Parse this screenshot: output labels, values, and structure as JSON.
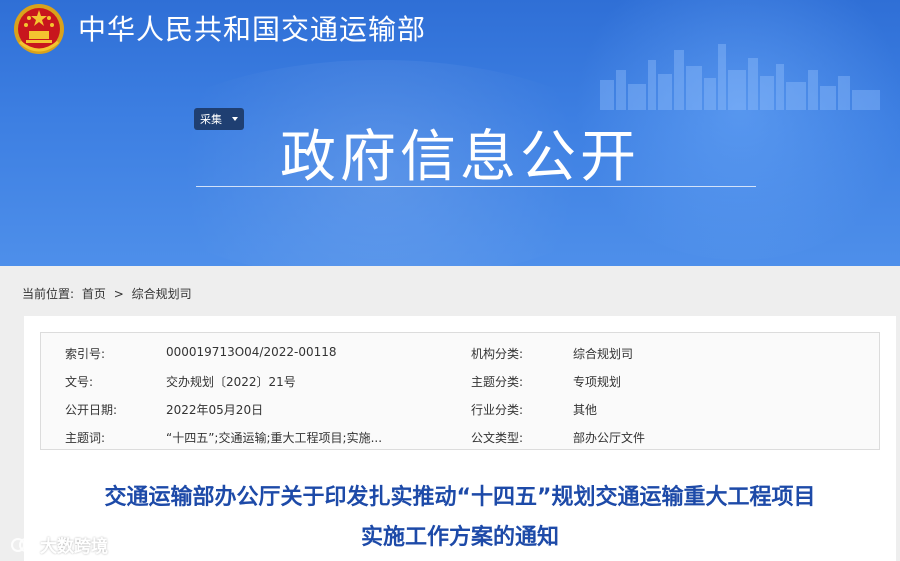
{
  "header": {
    "site_title": "中华人民共和国交通运输部",
    "dropdown_label": "采集",
    "section_title": "政府信息公开",
    "colors": {
      "banner_blue": "#3d7fe2",
      "title_blue": "#1d4aa8",
      "dropdown_bg": "#1f3f72"
    }
  },
  "breadcrumb": {
    "label": "当前位置:",
    "home": "首页",
    "separator": ">",
    "current": "综合规划司"
  },
  "meta": [
    {
      "k1": "索引号:",
      "v1": "000019713O04/2022-00118",
      "k2": "机构分类:",
      "v2": "综合规划司"
    },
    {
      "k1": "文号:",
      "v1": "交办规划〔2022〕21号",
      "k2": "主题分类:",
      "v2": "专项规划"
    },
    {
      "k1": "公开日期:",
      "v1": "2022年05月20日",
      "k2": "行业分类:",
      "v2": "其他"
    },
    {
      "k1": "主题词:",
      "v1": "“十四五”;交通运输;重大工程项目;实施...",
      "k2": "公文类型:",
      "v2": "部办公厅文件"
    }
  ],
  "document": {
    "title_line1": "交通运输部办公厅关于印发扎实推动“十四五”规划交通运输重大工程项目",
    "title_line2": "实施工作方案的通知"
  },
  "watermark": {
    "text": "大数跨境"
  }
}
